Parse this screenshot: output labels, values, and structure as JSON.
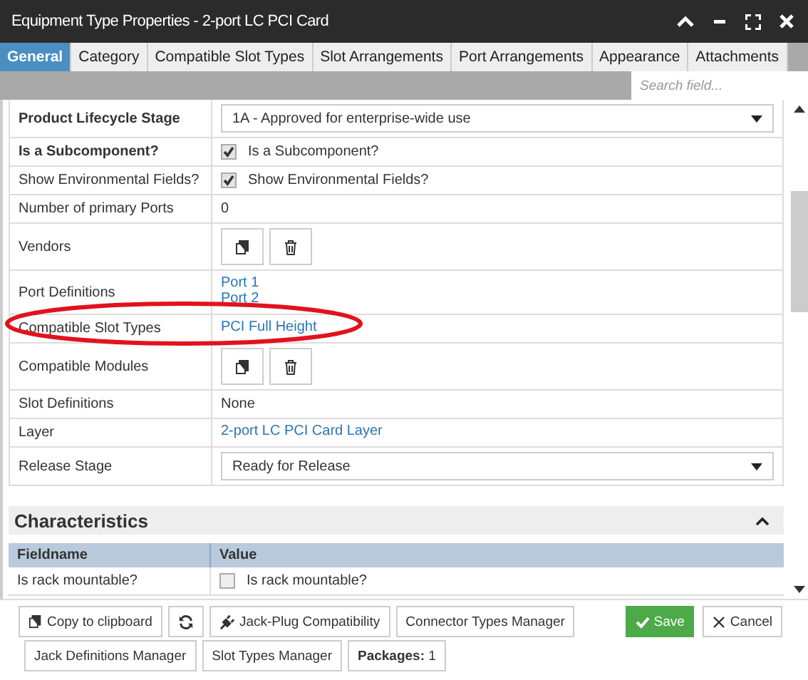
{
  "window": {
    "title": "Equipment Type Properties - 2-port LC PCI Card"
  },
  "tabs": [
    {
      "label": "General",
      "selected": true
    },
    {
      "label": "Category",
      "selected": false
    },
    {
      "label": "Compatible Slot Types",
      "selected": false
    },
    {
      "label": "Slot Arrangements",
      "selected": false
    },
    {
      "label": "Port Arrangements",
      "selected": false
    },
    {
      "label": "Appearance",
      "selected": false
    },
    {
      "label": "Attachments",
      "selected": false
    }
  ],
  "search": {
    "placeholder": "Search field..."
  },
  "fields": [
    {
      "label": "Product Lifecycle Stage",
      "emphasized": true,
      "kind": "select",
      "value": "1A - Approved for enterprise-wide use"
    },
    {
      "label": "Is a Subcomponent?",
      "emphasized": true,
      "kind": "checkbox",
      "checked": true,
      "text": "Is a Subcomponent?"
    },
    {
      "label": "Show Environmental Fields?",
      "emphasized": false,
      "kind": "checkbox",
      "checked": true,
      "text": "Show Environmental Fields?"
    },
    {
      "label": "Number of primary Ports",
      "emphasized": false,
      "kind": "text",
      "value": "0"
    },
    {
      "label": "Vendors",
      "emphasized": false,
      "kind": "actions"
    },
    {
      "label": "Port Definitions",
      "emphasized": false,
      "kind": "links",
      "links": [
        "Port 1",
        "Port 2"
      ]
    },
    {
      "label": "Compatible Slot Types",
      "emphasized": false,
      "kind": "links",
      "links": [
        "PCI Full Height"
      ]
    },
    {
      "label": "Compatible Modules",
      "emphasized": false,
      "kind": "actions"
    },
    {
      "label": "Slot Definitions",
      "emphasized": false,
      "kind": "text",
      "value": "None"
    },
    {
      "label": "Layer",
      "emphasized": false,
      "kind": "links",
      "links": [
        "2-port LC PCI Card Layer"
      ]
    },
    {
      "label": "Release Stage",
      "emphasized": false,
      "kind": "select",
      "value": "Ready for Release"
    }
  ],
  "characteristics": {
    "title": "Characteristics",
    "expanded": true,
    "columns": [
      "Fieldname",
      "Value"
    ],
    "rows": [
      {
        "label": "Is rack mountable?",
        "checked": false,
        "text": "Is rack mountable?"
      }
    ]
  },
  "footer_buttons": [
    {
      "label": "Copy to clipboard",
      "kind": "copy"
    },
    {
      "kind": "refresh"
    },
    {
      "label": "Jack-Plug Compatibility",
      "kind": "plug"
    },
    {
      "label": "Connector Types Manager",
      "kind": "plain"
    },
    {
      "label": "Jack Definitions Manager",
      "kind": "plain"
    },
    {
      "label": "Slot Types Manager",
      "kind": "plain"
    },
    {
      "label": "**Packages:** 1",
      "kind": "plain"
    }
  ],
  "dialog_buttons": [
    {
      "label": "Save",
      "kind": "save"
    },
    {
      "label": "Cancel",
      "kind": "cancel"
    }
  ]
}
